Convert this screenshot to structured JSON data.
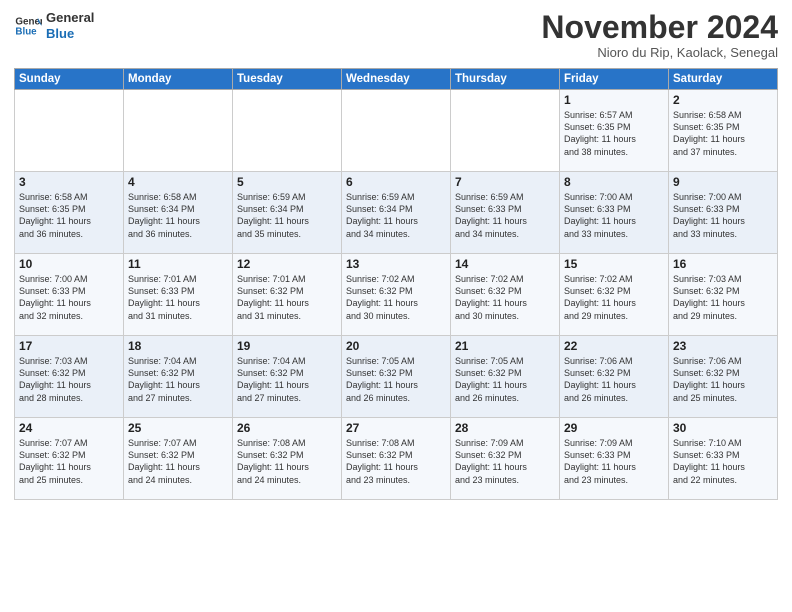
{
  "logo": {
    "line1": "General",
    "line2": "Blue"
  },
  "title": "November 2024",
  "subtitle": "Nioro du Rip, Kaolack, Senegal",
  "days_header": [
    "Sunday",
    "Monday",
    "Tuesday",
    "Wednesday",
    "Thursday",
    "Friday",
    "Saturday"
  ],
  "weeks": [
    [
      {
        "day": "",
        "info": ""
      },
      {
        "day": "",
        "info": ""
      },
      {
        "day": "",
        "info": ""
      },
      {
        "day": "",
        "info": ""
      },
      {
        "day": "",
        "info": ""
      },
      {
        "day": "1",
        "info": "Sunrise: 6:57 AM\nSunset: 6:35 PM\nDaylight: 11 hours\nand 38 minutes."
      },
      {
        "day": "2",
        "info": "Sunrise: 6:58 AM\nSunset: 6:35 PM\nDaylight: 11 hours\nand 37 minutes."
      }
    ],
    [
      {
        "day": "3",
        "info": "Sunrise: 6:58 AM\nSunset: 6:35 PM\nDaylight: 11 hours\nand 36 minutes."
      },
      {
        "day": "4",
        "info": "Sunrise: 6:58 AM\nSunset: 6:34 PM\nDaylight: 11 hours\nand 36 minutes."
      },
      {
        "day": "5",
        "info": "Sunrise: 6:59 AM\nSunset: 6:34 PM\nDaylight: 11 hours\nand 35 minutes."
      },
      {
        "day": "6",
        "info": "Sunrise: 6:59 AM\nSunset: 6:34 PM\nDaylight: 11 hours\nand 34 minutes."
      },
      {
        "day": "7",
        "info": "Sunrise: 6:59 AM\nSunset: 6:33 PM\nDaylight: 11 hours\nand 34 minutes."
      },
      {
        "day": "8",
        "info": "Sunrise: 7:00 AM\nSunset: 6:33 PM\nDaylight: 11 hours\nand 33 minutes."
      },
      {
        "day": "9",
        "info": "Sunrise: 7:00 AM\nSunset: 6:33 PM\nDaylight: 11 hours\nand 33 minutes."
      }
    ],
    [
      {
        "day": "10",
        "info": "Sunrise: 7:00 AM\nSunset: 6:33 PM\nDaylight: 11 hours\nand 32 minutes."
      },
      {
        "day": "11",
        "info": "Sunrise: 7:01 AM\nSunset: 6:33 PM\nDaylight: 11 hours\nand 31 minutes."
      },
      {
        "day": "12",
        "info": "Sunrise: 7:01 AM\nSunset: 6:32 PM\nDaylight: 11 hours\nand 31 minutes."
      },
      {
        "day": "13",
        "info": "Sunrise: 7:02 AM\nSunset: 6:32 PM\nDaylight: 11 hours\nand 30 minutes."
      },
      {
        "day": "14",
        "info": "Sunrise: 7:02 AM\nSunset: 6:32 PM\nDaylight: 11 hours\nand 30 minutes."
      },
      {
        "day": "15",
        "info": "Sunrise: 7:02 AM\nSunset: 6:32 PM\nDaylight: 11 hours\nand 29 minutes."
      },
      {
        "day": "16",
        "info": "Sunrise: 7:03 AM\nSunset: 6:32 PM\nDaylight: 11 hours\nand 29 minutes."
      }
    ],
    [
      {
        "day": "17",
        "info": "Sunrise: 7:03 AM\nSunset: 6:32 PM\nDaylight: 11 hours\nand 28 minutes."
      },
      {
        "day": "18",
        "info": "Sunrise: 7:04 AM\nSunset: 6:32 PM\nDaylight: 11 hours\nand 27 minutes."
      },
      {
        "day": "19",
        "info": "Sunrise: 7:04 AM\nSunset: 6:32 PM\nDaylight: 11 hours\nand 27 minutes."
      },
      {
        "day": "20",
        "info": "Sunrise: 7:05 AM\nSunset: 6:32 PM\nDaylight: 11 hours\nand 26 minutes."
      },
      {
        "day": "21",
        "info": "Sunrise: 7:05 AM\nSunset: 6:32 PM\nDaylight: 11 hours\nand 26 minutes."
      },
      {
        "day": "22",
        "info": "Sunrise: 7:06 AM\nSunset: 6:32 PM\nDaylight: 11 hours\nand 26 minutes."
      },
      {
        "day": "23",
        "info": "Sunrise: 7:06 AM\nSunset: 6:32 PM\nDaylight: 11 hours\nand 25 minutes."
      }
    ],
    [
      {
        "day": "24",
        "info": "Sunrise: 7:07 AM\nSunset: 6:32 PM\nDaylight: 11 hours\nand 25 minutes."
      },
      {
        "day": "25",
        "info": "Sunrise: 7:07 AM\nSunset: 6:32 PM\nDaylight: 11 hours\nand 24 minutes."
      },
      {
        "day": "26",
        "info": "Sunrise: 7:08 AM\nSunset: 6:32 PM\nDaylight: 11 hours\nand 24 minutes."
      },
      {
        "day": "27",
        "info": "Sunrise: 7:08 AM\nSunset: 6:32 PM\nDaylight: 11 hours\nand 23 minutes."
      },
      {
        "day": "28",
        "info": "Sunrise: 7:09 AM\nSunset: 6:32 PM\nDaylight: 11 hours\nand 23 minutes."
      },
      {
        "day": "29",
        "info": "Sunrise: 7:09 AM\nSunset: 6:33 PM\nDaylight: 11 hours\nand 23 minutes."
      },
      {
        "day": "30",
        "info": "Sunrise: 7:10 AM\nSunset: 6:33 PM\nDaylight: 11 hours\nand 22 minutes."
      }
    ]
  ]
}
